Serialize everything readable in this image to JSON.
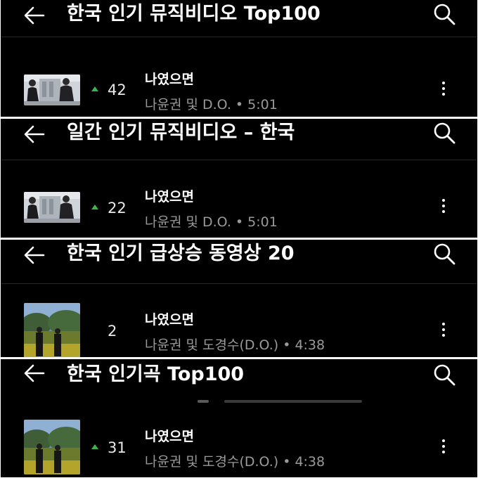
{
  "panels": [
    {
      "title": "한국 인기 뮤직비디오 Top100",
      "track": {
        "rank": "42",
        "title": "나였으면",
        "meta": "나윤권 및 D.O. • 5:01"
      }
    },
    {
      "title": "일간 인기 뮤직비디오 – 한국",
      "track": {
        "rank": "22",
        "title": "나였으면",
        "meta": "나윤권 및 D.O. • 5:01"
      }
    },
    {
      "title": "한국 인기 급상승 동영상 20",
      "track": {
        "rank": "2",
        "title": "나였으면",
        "meta": "나윤권 및 도경수(D.O.) • 4:38"
      }
    },
    {
      "title": "한국 인기곡 Top100",
      "track": {
        "rank": "31",
        "title": "나였으면",
        "meta": "나윤권 및 도경수(D.O.) • 4:38"
      }
    }
  ],
  "icons": {
    "back": "arrow-left-icon",
    "search": "search-icon",
    "more": "more-vert-icon",
    "trend_up": "triangle-up-icon"
  },
  "colors": {
    "background": "#000000",
    "text_primary": "#ffffff",
    "text_secondary": "#9a9a9a",
    "trend_up": "#3bb54a"
  }
}
